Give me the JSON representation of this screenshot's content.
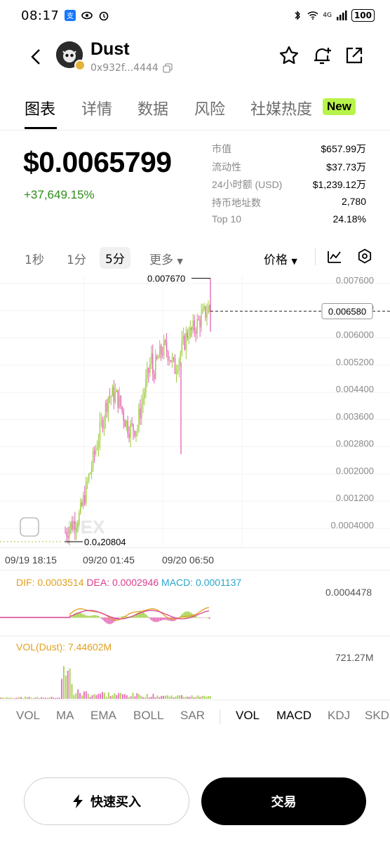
{
  "status": {
    "time": "08:17",
    "network": "4G",
    "battery": "100"
  },
  "header": {
    "token_name": "Dust",
    "address": "0x932f...4444"
  },
  "tabs": [
    {
      "label": "图表"
    },
    {
      "label": "详情"
    },
    {
      "label": "数据"
    },
    {
      "label": "风险"
    },
    {
      "label": "社媒热度"
    }
  ],
  "new_badge": "New",
  "price": {
    "value": "$0.0065799",
    "change": "+37,649.15%"
  },
  "stats": [
    {
      "label": "市值",
      "value": "$657.99万"
    },
    {
      "label": "流动性",
      "value": "$37.73万"
    },
    {
      "label": "24小时额 (USD)",
      "value": "$1,239.12万"
    },
    {
      "label": "持币地址数",
      "value": "2,780"
    },
    {
      "label": "Top 10",
      "value": "24.18%"
    }
  ],
  "toolbar": {
    "intervals": [
      "1秒",
      "1分",
      "5分"
    ],
    "more": "更多",
    "price_type": "价格"
  },
  "chart": {
    "y_ticks": [
      "0.007600",
      "0.006800",
      "0.006000",
      "0.005200",
      "0.004400",
      "0.003600",
      "0.002800",
      "0.002000",
      "0.001200",
      "0.0004000"
    ],
    "high_label": "0.007670",
    "low_label": "0.0₄20804",
    "current_label": "0.006580",
    "watermark": "DEX",
    "time_labels": [
      "09/19 18:15",
      "09/20 01:45",
      "09/20 06:50"
    ],
    "up_color": "#9ccb3b",
    "down_color": "#e35fb0"
  },
  "macd": {
    "dif_label": "DIF: 0.0003514",
    "dea_label": "DEA: 0.0002946",
    "macd_label": "MACD: 0.0001137",
    "right_value": "0.0004478"
  },
  "volume": {
    "label": "VOL(Dust): 7.44602M",
    "right_value": "721.27M"
  },
  "indicators": {
    "main": [
      "VOL",
      "MA",
      "EMA",
      "BOLL",
      "SAR"
    ],
    "sub": [
      "VOL",
      "MACD",
      "KDJ",
      "SKD"
    ]
  },
  "actions": {
    "quick_buy": "快速买入",
    "trade": "交易"
  }
}
